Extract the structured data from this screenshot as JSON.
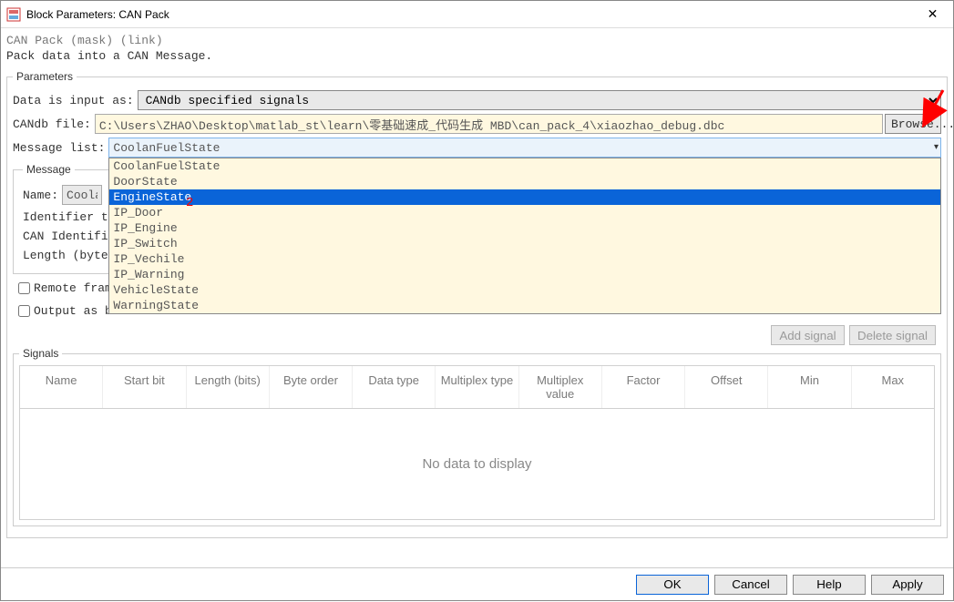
{
  "window": {
    "title": "Block Parameters: CAN Pack",
    "mask_line": "CAN Pack  (mask) (link)",
    "desc_line": "Pack data into a CAN Message."
  },
  "parameters": {
    "legend": "Parameters",
    "data_input_label": "Data is input as:",
    "data_input_value": "CANdb specified signals",
    "candb_file_label": "CANdb file:",
    "candb_file_value": "C:\\Users\\ZHAO\\Desktop\\matlab_st\\learn\\零基础速成_代码生成 MBD\\can_pack_4\\xiaozhao_debug.dbc",
    "browse_label": "Browse...",
    "message_list_label": "Message list:",
    "message_list_selected": "CoolanFuelState",
    "message_list_options": [
      "CoolanFuelState",
      "DoorState",
      "EngineState",
      "IP_Door",
      "IP_Engine",
      "IP_Switch",
      "IP_Vechile",
      "IP_Warning",
      "VehicleState",
      "WarningState"
    ],
    "message_list_highlight_index": 2
  },
  "message_group": {
    "legend": "Message",
    "name_label": "Name:",
    "name_value_partial": "Coolan",
    "identifier_type_label": "Identifier ty",
    "can_identifier_label": "CAN Identifie",
    "length_label": "Length (bytes",
    "remote_frame_label": "Remote frame",
    "output_as_bus_label": "Output as bus"
  },
  "signal_buttons": {
    "add": "Add signal",
    "delete": "Delete signal"
  },
  "signals_group": {
    "legend": "Signals",
    "columns": [
      "Name",
      "Start bit",
      "Length (bits)",
      "Byte order",
      "Data type",
      "Multiplex type",
      "Multiplex value",
      "Factor",
      "Offset",
      "Min",
      "Max"
    ],
    "empty_text": "No data to display"
  },
  "footer": {
    "ok": "OK",
    "cancel": "Cancel",
    "help": "Help",
    "apply": "Apply"
  },
  "annotations": {
    "two": "2"
  }
}
